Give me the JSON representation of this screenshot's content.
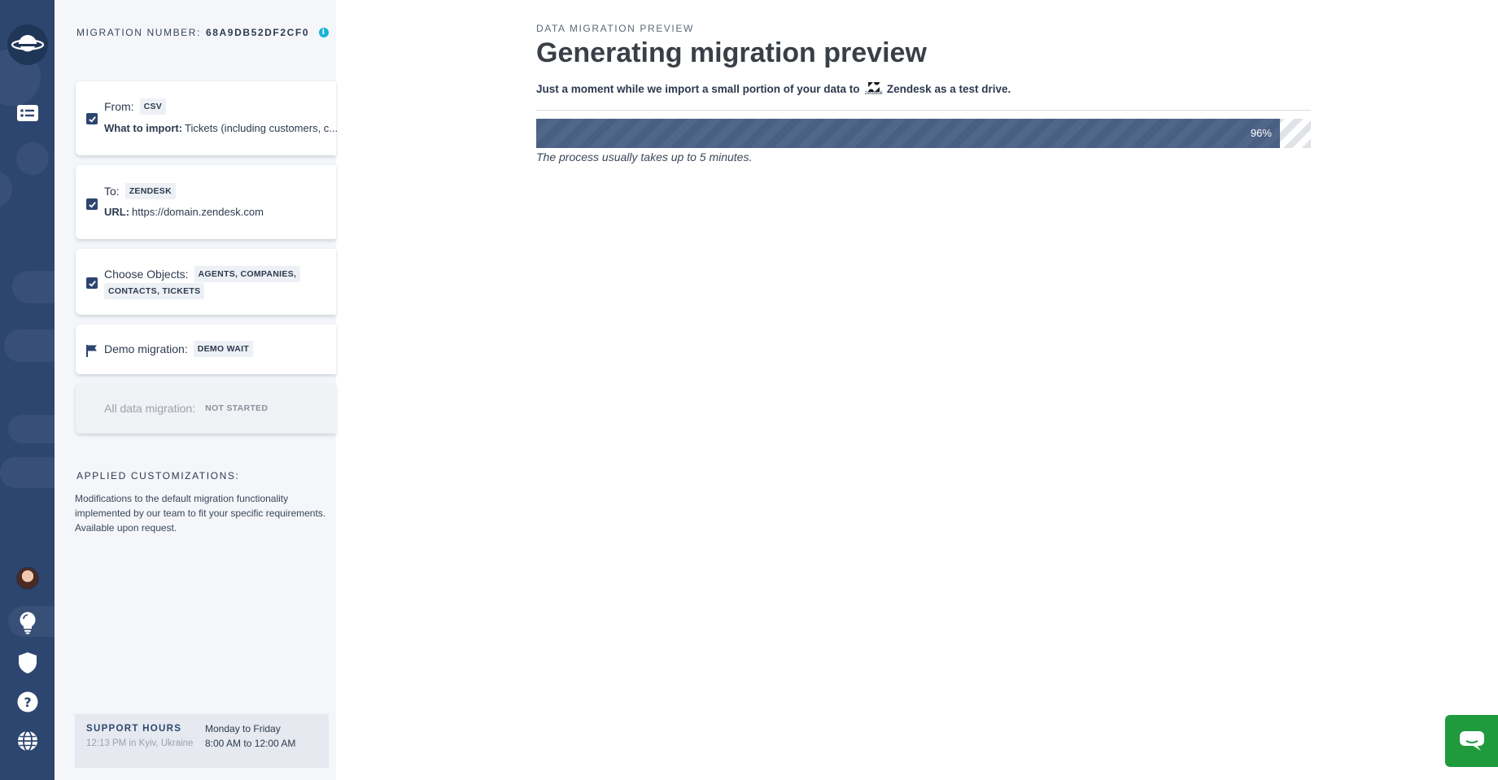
{
  "brand": {
    "accent": "#2c4670",
    "progress_fill": "#4a6082",
    "chat_green": "#1f9a3c",
    "info_cyan": "#19b3d6"
  },
  "rail": {
    "icons": [
      "planet-logo-icon",
      "list-icon",
      "avatar",
      "lightbulb-icon",
      "shield-icon",
      "help-icon",
      "globe-icon"
    ]
  },
  "sidebar": {
    "migration_label": "MIGRATION NUMBER:",
    "migration_number": "68A9DB52DF2CF0",
    "cards": {
      "from": {
        "label": "From:",
        "tag": "CSV",
        "import_label": "What to import:",
        "import_value": "Tickets (including customers, c..."
      },
      "to": {
        "label": "To:",
        "tag": "ZENDESK",
        "url_label": "URL:",
        "url_value": "https://domain.zendesk.com"
      },
      "objects": {
        "label": "Choose Objects:",
        "tag1": "AGENTS, COMPANIES,",
        "tag2": "CONTACTS, TICKETS"
      },
      "demo": {
        "label": "Demo migration:",
        "tag": "DEMO WAIT"
      },
      "all": {
        "label": "All data migration:",
        "tag": "NOT STARTED"
      }
    },
    "customizations": {
      "title": "APPLIED CUSTOMIZATIONS:",
      "text": "Modifications to the default migration functionality implemented by our team to fit your specific requirements. Available upon request."
    },
    "support": {
      "title": "SUPPORT HOURS",
      "local_time": "12:13 PM in Kyiv, Ukraine",
      "days": "Monday to Friday",
      "hours": "8:00 AM to 12:00 AM"
    }
  },
  "main": {
    "eyebrow": "DATA MIGRATION PREVIEW",
    "title": "Generating migration preview",
    "subtitle_before": "Just a moment while we import a small portion of your data to",
    "logo_small_text": "zendesk",
    "subtitle_after": "Zendesk as a test drive.",
    "progress": {
      "value": 96,
      "label": "96%"
    },
    "note": "The process usually takes up to 5 minutes."
  }
}
